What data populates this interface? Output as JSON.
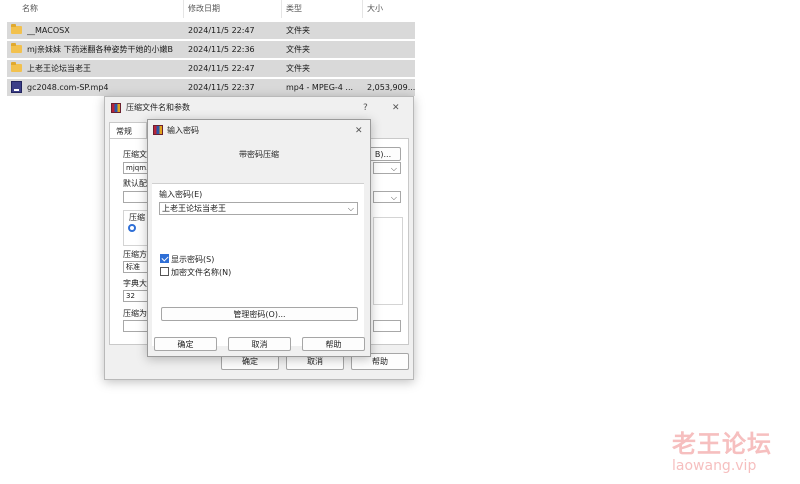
{
  "explorer": {
    "columns": {
      "name": "名称",
      "modified": "修改日期",
      "type": "类型",
      "size": "大小"
    },
    "rows": [
      {
        "name": "__MACOSX",
        "modified": "2024/11/5 22:47",
        "type": "文件夹",
        "size": "",
        "icon": "folder-icon"
      },
      {
        "name": "mj亲妹妹 下药迷翻各种姿势干她的小嫩B",
        "modified": "2024/11/5 22:36",
        "type": "文件夹",
        "size": "",
        "icon": "folder-icon"
      },
      {
        "name": "上老王论坛当老王",
        "modified": "2024/11/5 22:47",
        "type": "文件夹",
        "size": "",
        "icon": "folder-icon"
      },
      {
        "name": "gc2048.com-SP.mp4",
        "modified": "2024/11/5 22:37",
        "type": "mp4 - MPEG-4 ...",
        "size": "2,053,909...",
        "icon": "mp4-icon"
      }
    ]
  },
  "archive_dialog": {
    "title": "压缩文件名和参数",
    "help": "?",
    "close": "✕",
    "tab": "常规",
    "archive_name_label": "压缩文",
    "archive_name_value": "mjqm.z",
    "browse_label": "B)...",
    "profile_label": "默认配",
    "format_label": "压缩",
    "compress_method_label": "压缩方",
    "compress_method_value": "标准",
    "dict_label": "字典大",
    "dict_value": "32",
    "split_label": "压缩为",
    "ok": "确定",
    "cancel": "取消",
    "help_button": "帮助"
  },
  "password_dialog": {
    "title": "输入密码",
    "close": "✕",
    "header": "带密码压缩",
    "password_label": "输入密码(E)",
    "password_value": "上老王论坛当老王",
    "show_password_label": "显示密码(S)",
    "show_password_checked": true,
    "encrypt_names_label": "加密文件名称(N)",
    "encrypt_names_checked": false,
    "manage_button": "管理密码(O)...",
    "ok": "确定",
    "cancel": "取消",
    "help_button": "帮助"
  },
  "watermark": {
    "line1": "老王论坛",
    "line2": "laowang.vip"
  }
}
